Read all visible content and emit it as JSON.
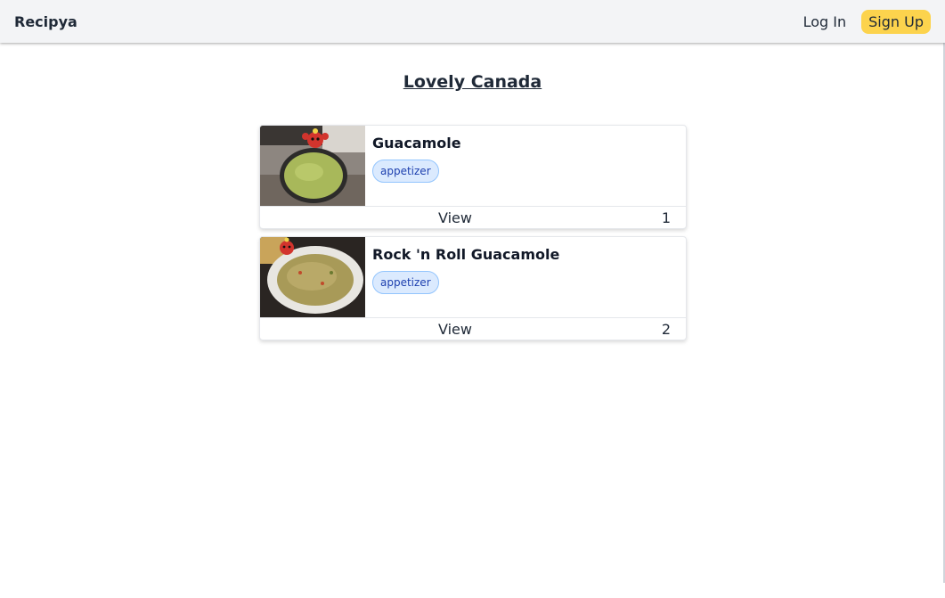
{
  "navbar": {
    "brand": "Recipya",
    "login_label": "Log In",
    "signup_label": "Sign Up",
    "accent_color": "#fcd34d"
  },
  "page": {
    "title": "Lovely Canada"
  },
  "recipes": [
    {
      "name": "Guacamole",
      "tag": "appetizer",
      "view_label": "View",
      "index": "1",
      "image": "guacamole-bowl-photo"
    },
    {
      "name": "Rock 'n Roll Guacamole",
      "tag": "appetizer",
      "view_label": "View",
      "index": "2",
      "image": "guacamole-plate-photo"
    }
  ]
}
